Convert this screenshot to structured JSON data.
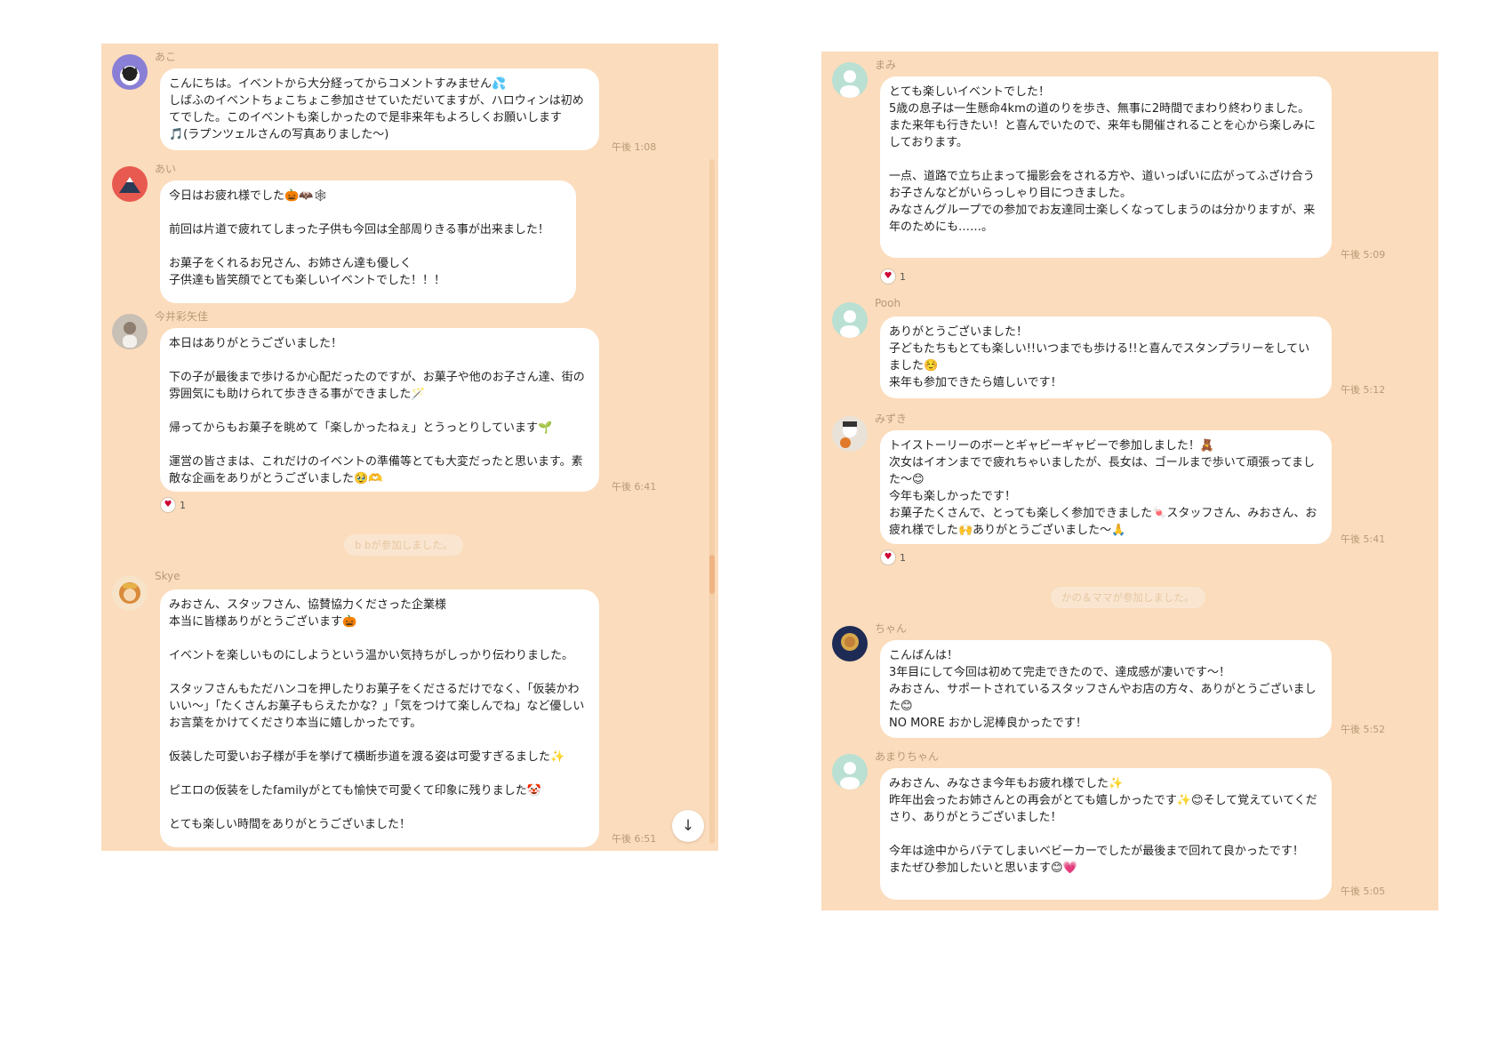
{
  "left_panel": {
    "messages": [
      {
        "sender": "あこ",
        "text": "こんにちは。イベントから大分経ってからコメントすみません💦\nしばふのイベントちょこちょこ参加させていただいてますが、ハロウィンは初めてでした。このイベントも楽しかったので是非来年もよろしくお願いします🎵(ラプンツェルさんの写真ありました〜)",
        "time": "午後 1:08"
      },
      {
        "sender": "あい",
        "text": "今日はお疲れ様でした🎃🦇🕸\n\n前回は片道で疲れてしまった子供も今回は全部周りきる事が出来ました！\n\nお菓子をくれるお兄さん、お姉さん達も優しく\n子供達も皆笑顔でとても楽しいイベントでした！！！",
        "time": ""
      },
      {
        "sender": "今井彩矢佳",
        "text": "本日はありがとうございました！\n\n下の子が最後まで歩けるか心配だったのですが、お菓子や他のお子さん達、街の雰囲気にも助けられて歩ききる事ができました🪄\n\n帰ってからもお菓子を眺めて「楽しかったねぇ」とうっとりしています🌱\n\n運営の皆さまは、これだけのイベントの準備等とても大変だったと思います。素敵な企画をありがとうございました🥹🫶",
        "time": "午後 6:41",
        "reaction": "1"
      },
      {
        "sender": "Skye",
        "text": "みおさん、スタッフさん、協賛協力くださった企業様\n本当に皆様ありがとうございます🎃\n\nイベントを楽しいものにしようという温かい気持ちがしっかり伝わりました。\n\nスタッフさんもただハンコを押したりお菓子をくださるだけでなく、「仮装かわいい〜」「たくさんお菓子もらえたかな？」「気をつけて楽しんでね」など優しいお言葉をかけてくださり本当に嬉しかったです。\n\n仮装した可愛いお子様が手を挙げて横断歩道を渡る姿は可愛すぎるました✨\n\nピエロの仮装をしたfamilyがとても愉快で可愛くて印象に残りました🤡\n\nとても楽しい時間をありがとうございました！",
        "time": "午後 6:51"
      }
    ],
    "join_notice": "b bが参加しました。",
    "scroll_down_icon": "↓"
  },
  "right_panel": {
    "messages": [
      {
        "sender": "まみ",
        "text": "とても楽しいイベントでした！\n5歳の息子は一生懸命4kmの道のりを歩き、無事に2時間でまわり終わりました。\nまた来年も行きたい！と喜んでいたので、来年も開催されることを心から楽しみにしております。\n\n一点、道路で立ち止まって撮影会をされる方や、道いっぱいに広がってふざけ合うお子さんなどがいらっしゃり目につきました。\nみなさんグループでの参加でお友達同士楽しくなってしまうのは分かりますが、来年のためにも……。",
        "time": "午後 5:09",
        "reaction": "1"
      },
      {
        "sender": "Pooh",
        "text": "ありがとうございました！\n子どもたちもとても楽しい!!いつまでも歩ける!!と喜んでスタンプラリーをしていました☺️\n来年も参加できたら嬉しいです！",
        "time": "午後 5:12"
      },
      {
        "sender": "みずき",
        "text": "トイストーリーのボーとギャビーギャビーで参加しました！🧸\n次女はイオンまでで疲れちゃいましたが、長女は、ゴールまで歩いて頑張ってました〜😊\n今年も楽しかったです！\nお菓子たくさんで、とっても楽しく参加できました🍬スタッフさん、みおさん、お疲れ様でした🙌ありがとうございました〜🙏",
        "time": "午後 5:41",
        "reaction": "1"
      },
      {
        "sender": "ちゃん",
        "text": "こんばんは！\n3年目にして今回は初めて完走できたので、達成感が凄いです〜！\nみおさん、サポートされているスタッフさんやお店の方々、ありがとうございました😊\nNO MORE おかし泥棒良かったです！",
        "time": "午後 5:52"
      },
      {
        "sender": "あまりちゃん",
        "text": "みおさん、みなさま今年もお疲れ様でした✨\n昨年出会ったお姉さんとの再会がとても嬉しかったです✨😊そして覚えていてくださり、ありがとうございました！\n\n今年は途中からバテてしまいベビーカーでしたが最後まで回れて良かったです！\nまたぜひ参加したいと思います😊💗",
        "time": "午後 5:05"
      }
    ],
    "join_notice": "かの＆ママが参加しました。"
  },
  "colors": {
    "panel_bg": "#fbdcbc",
    "bubble_bg": "#ffffff",
    "meta_text": "#b89a78"
  }
}
